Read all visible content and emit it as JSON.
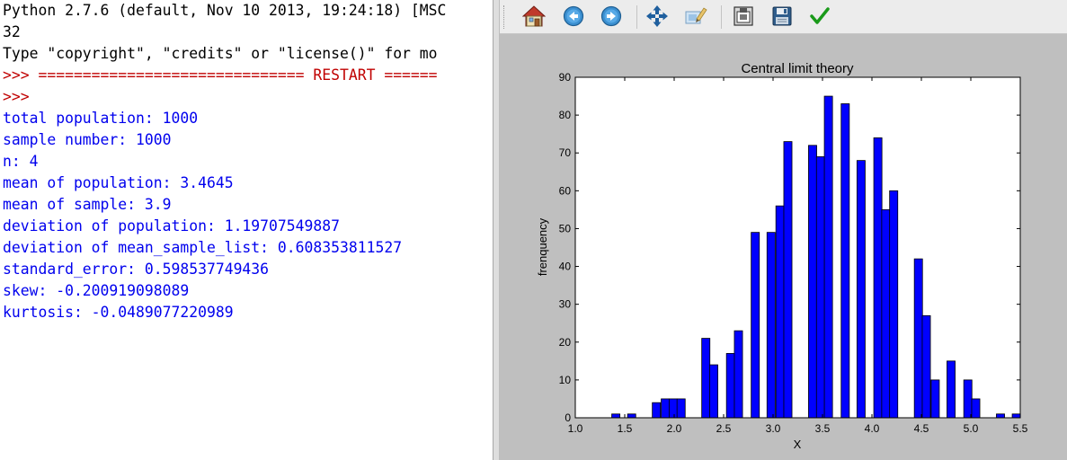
{
  "shell": {
    "lines": [
      {
        "text": "Python 2.7.6 (default, Nov 10 2013, 19:24:18) [MSC",
        "color": "black"
      },
      {
        "text": "32",
        "color": "black"
      },
      {
        "text": "Type \"copyright\", \"credits\" or \"license()\" for mo",
        "color": "black"
      },
      {
        "text": ">>> ============================== RESTART ======",
        "color": "red"
      },
      {
        "text": ">>>",
        "color": "red"
      },
      {
        "text": "total population: 1000",
        "color": "blue"
      },
      {
        "text": "sample number: 1000",
        "color": "blue"
      },
      {
        "text": "n: 4",
        "color": "blue"
      },
      {
        "text": "mean of population: 3.4645",
        "color": "blue"
      },
      {
        "text": "mean of sample: 3.9",
        "color": "blue"
      },
      {
        "text": "deviation of population: 1.19707549887",
        "color": "blue"
      },
      {
        "text": "deviation of mean_sample_list: 0.608353811527",
        "color": "blue"
      },
      {
        "text": "standard_error: 0.598537749436",
        "color": "blue"
      },
      {
        "text": "skew: -0.200919098089",
        "color": "blue"
      },
      {
        "text": "kurtosis: -0.0489077220989",
        "color": "blue"
      }
    ]
  },
  "toolbar": {
    "buttons": [
      {
        "name": "home-icon"
      },
      {
        "name": "back-icon"
      },
      {
        "name": "forward-icon"
      },
      {
        "name": "pan-icon"
      },
      {
        "name": "zoom-icon"
      },
      {
        "name": "subplots-icon"
      },
      {
        "name": "save-icon"
      },
      {
        "name": "edit-check-icon"
      }
    ]
  },
  "colors": {
    "bar": "#0000ff",
    "shell_output": "#0000ee",
    "shell_prompt": "#c00000",
    "figure_bg": "#bfbfbf"
  },
  "chart_data": {
    "type": "bar",
    "title": "Central limit theory",
    "xlabel": "X",
    "ylabel": "frenquency",
    "xlim": [
      1.0,
      5.5
    ],
    "ylim": [
      0,
      90
    ],
    "xticks": [
      "1.0",
      "1.5",
      "2.0",
      "2.5",
      "3.0",
      "3.5",
      "4.0",
      "4.5",
      "5.0",
      "5.5"
    ],
    "yticks": [
      "0",
      "10",
      "20",
      "30",
      "40",
      "50",
      "60",
      "70",
      "80",
      "90"
    ],
    "grid": false,
    "bin_width": 0.0825,
    "bins": [
      {
        "x": 1.41,
        "value": 1
      },
      {
        "x": 1.57,
        "value": 1
      },
      {
        "x": 1.82,
        "value": 4
      },
      {
        "x": 1.91,
        "value": 5
      },
      {
        "x": 1.99,
        "value": 5
      },
      {
        "x": 2.07,
        "value": 5
      },
      {
        "x": 2.32,
        "value": 21
      },
      {
        "x": 2.4,
        "value": 14
      },
      {
        "x": 2.57,
        "value": 17
      },
      {
        "x": 2.65,
        "value": 23
      },
      {
        "x": 2.82,
        "value": 49
      },
      {
        "x": 2.98,
        "value": 49
      },
      {
        "x": 3.07,
        "value": 56
      },
      {
        "x": 3.15,
        "value": 73
      },
      {
        "x": 3.4,
        "value": 72
      },
      {
        "x": 3.48,
        "value": 69
      },
      {
        "x": 3.56,
        "value": 85
      },
      {
        "x": 3.73,
        "value": 83
      },
      {
        "x": 3.89,
        "value": 68
      },
      {
        "x": 4.06,
        "value": 74
      },
      {
        "x": 4.14,
        "value": 55
      },
      {
        "x": 4.22,
        "value": 60
      },
      {
        "x": 4.47,
        "value": 42
      },
      {
        "x": 4.55,
        "value": 27
      },
      {
        "x": 4.64,
        "value": 10
      },
      {
        "x": 4.8,
        "value": 15
      },
      {
        "x": 4.97,
        "value": 10
      },
      {
        "x": 5.05,
        "value": 5
      },
      {
        "x": 5.3,
        "value": 1
      },
      {
        "x": 5.46,
        "value": 1
      }
    ]
  }
}
